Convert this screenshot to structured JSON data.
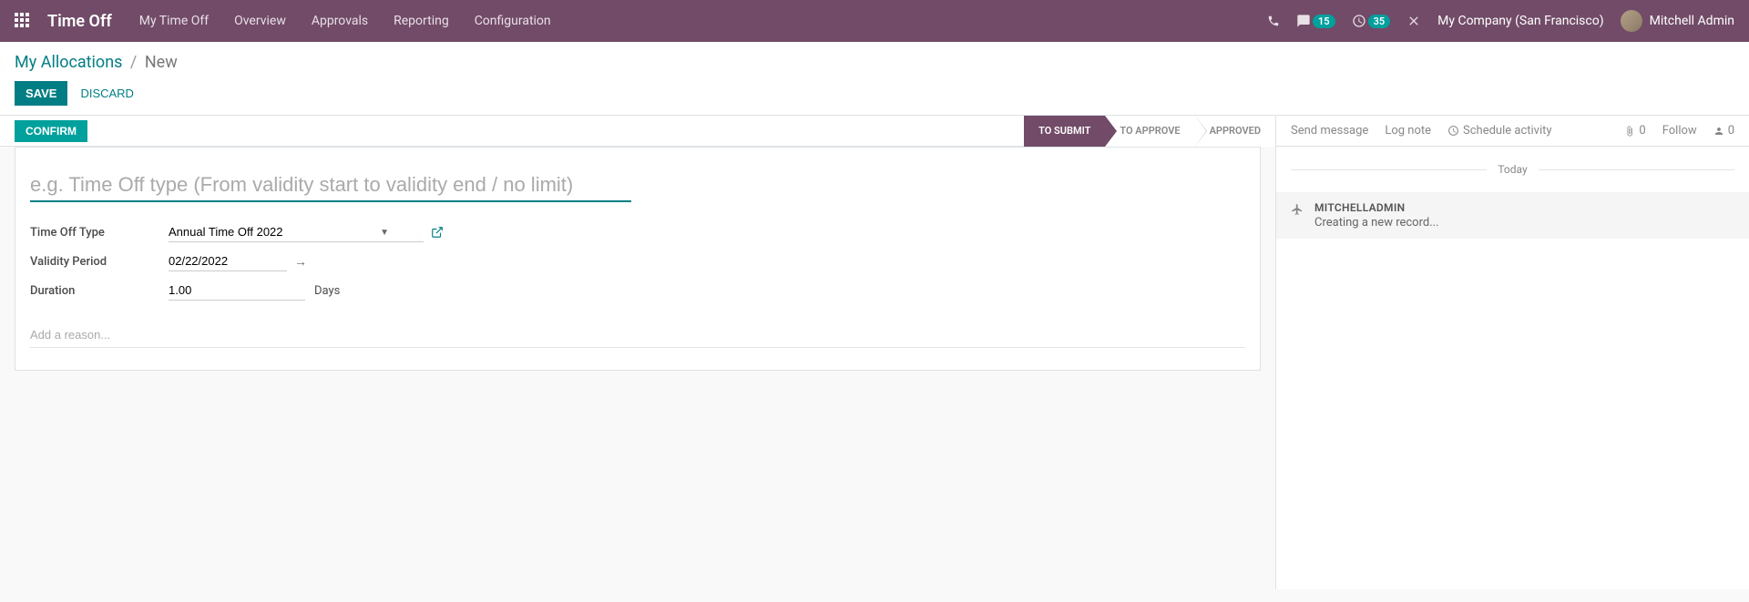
{
  "nav": {
    "brand": "Time Off",
    "links": [
      "My Time Off",
      "Overview",
      "Approvals",
      "Reporting",
      "Configuration"
    ],
    "messages_count": "15",
    "activities_count": "35",
    "company": "My Company (San Francisco)",
    "user": "Mitchell Admin"
  },
  "breadcrumb": {
    "parent": "My Allocations",
    "current": "New"
  },
  "buttons": {
    "save": "SAVE",
    "discard": "DISCARD",
    "confirm": "CONFIRM"
  },
  "status": {
    "steps": [
      "TO SUBMIT",
      "TO APPROVE",
      "APPROVED"
    ],
    "active_index": 0
  },
  "form": {
    "title_placeholder": "e.g. Time Off type (From validity start to validity end / no limit)",
    "title_value": "",
    "fields": {
      "type_label": "Time Off Type",
      "type_value": "Annual Time Off 2022",
      "validity_label": "Validity Period",
      "validity_value": "02/22/2022",
      "duration_label": "Duration",
      "duration_value": "1.00",
      "duration_unit": "Days",
      "reason_placeholder": "Add a reason..."
    }
  },
  "chatter": {
    "send_message": "Send message",
    "log_note": "Log note",
    "schedule_activity": "Schedule activity",
    "attachments": "0",
    "follow": "Follow",
    "followers": "0",
    "today": "Today",
    "message": {
      "author": "MITCHELLADMIN",
      "text": "Creating a new record..."
    }
  }
}
